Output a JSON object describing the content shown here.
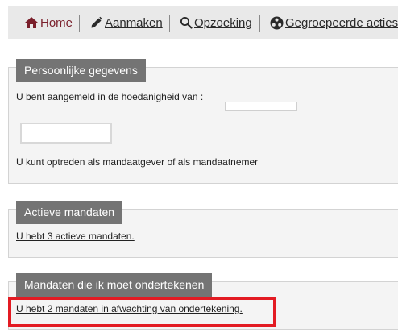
{
  "nav": {
    "home": {
      "label": "Home",
      "icon": "home-icon"
    },
    "create": {
      "label": "Aanmaken",
      "icon": "pencil-icon"
    },
    "search": {
      "label": "Opzoeking",
      "icon": "search-icon"
    },
    "grouped": {
      "label": "Gegroepeerde acties",
      "icon": "group-icon"
    }
  },
  "personal": {
    "title": "Persoonlijke gegevens",
    "logged_in_as": "U bent aangemeld in de hoedanigheid van :",
    "can_act_as": "U kunt optreden als mandaatgever of als mandaatnemer"
  },
  "active_mandates": {
    "title": "Actieve mandaten",
    "link": "U hebt 3 actieve mandaten."
  },
  "to_sign": {
    "title": "Mandaten die ik moet ondertekenen",
    "link": "U hebt 2 mandaten in afwachting van ondertekening."
  },
  "colors": {
    "nav_bg": "#e9e9e9",
    "home_accent": "#7a1f2b",
    "panel_title_bg": "#747474",
    "highlight": "#e31b23"
  }
}
